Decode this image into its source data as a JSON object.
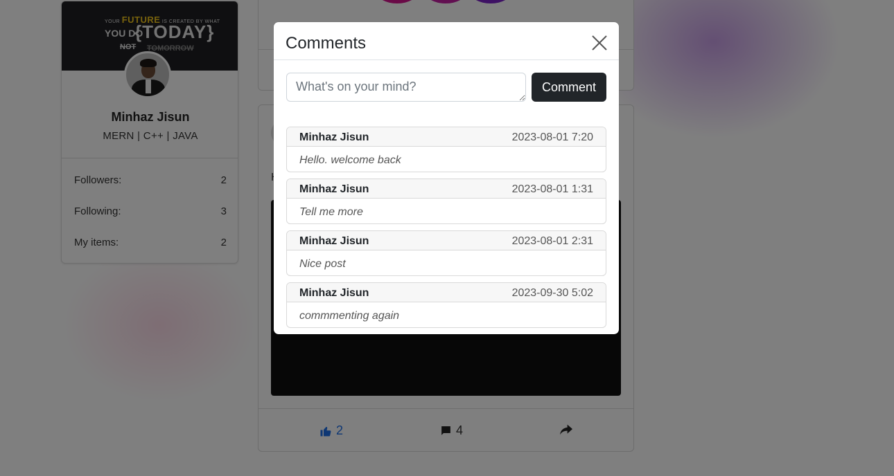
{
  "profile": {
    "cover_quote": {
      "line1_prefix": "YOUR",
      "line1_highlight": "FUTURE",
      "line1_suffix": "IS CREATED BY WHAT",
      "line2_prefix": "YOU DO",
      "line2_big": "{TODAY}",
      "line3_not": "NOT",
      "line3_word": "TOMORROW"
    },
    "name": "Minhaz Jisun",
    "tagline": "MERN | C++ | JAVA",
    "stats": [
      {
        "label": "Followers:",
        "value": "2"
      },
      {
        "label": "Following:",
        "value": "3"
      },
      {
        "label": "My items:",
        "value": "2"
      }
    ]
  },
  "post": {
    "text_start": "H",
    "likes": "2",
    "comments": "4"
  },
  "modal": {
    "title": "Comments",
    "input_placeholder": "What's on your mind?",
    "submit_label": "Comment",
    "comments": [
      {
        "author": "Minhaz Jisun",
        "time": "2023-08-01 7:20",
        "text": "Hello. welcome back"
      },
      {
        "author": "Minhaz Jisun",
        "time": "2023-08-01 1:31",
        "text": "Tell me more"
      },
      {
        "author": "Minhaz Jisun",
        "time": "2023-08-01 2:31",
        "text": "Nice post"
      },
      {
        "author": "Minhaz Jisun",
        "time": "2023-09-30 5:02",
        "text": "commmenting again"
      }
    ]
  },
  "colors": {
    "like_blue": "#1d6ee8",
    "button_dark": "#212529",
    "overlay": "rgba(0,0,0,0.5)"
  },
  "icons": [
    "close-icon",
    "thumbs-up-icon",
    "comment-icon",
    "share-icon"
  ]
}
